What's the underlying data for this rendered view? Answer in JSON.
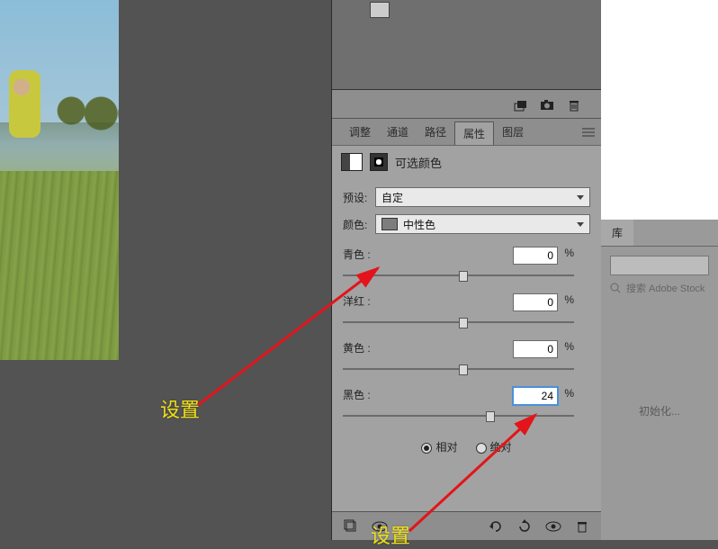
{
  "toolbar_icons": {
    "new_layer": "new-layer-icon",
    "camera": "camera-icon",
    "trash": "trash-icon"
  },
  "tabs": {
    "adjust": "调整",
    "channel": "通道",
    "path": "路径",
    "properties": "属性",
    "layers": "图层"
  },
  "adj_header": {
    "title": "可选颜色"
  },
  "preset": {
    "label": "预设:",
    "value": "自定"
  },
  "color": {
    "label": "颜色:",
    "value": "中性色"
  },
  "sliders": {
    "cyan": {
      "label": "青色 :",
      "value": "0",
      "unit": "%"
    },
    "magenta": {
      "label": "洋红 :",
      "value": "0",
      "unit": "%"
    },
    "yellow": {
      "label": "黄色 :",
      "value": "0",
      "unit": "%"
    },
    "black": {
      "label": "黑色 :",
      "value": "24",
      "unit": "%"
    }
  },
  "method": {
    "relative": "相对",
    "absolute": "绝对"
  },
  "library": {
    "tab": "库",
    "search_placeholder": "搜索 Adobe Stock",
    "init": "初始化..."
  },
  "annotations": {
    "setting1": "设置",
    "setting2": "设置"
  }
}
